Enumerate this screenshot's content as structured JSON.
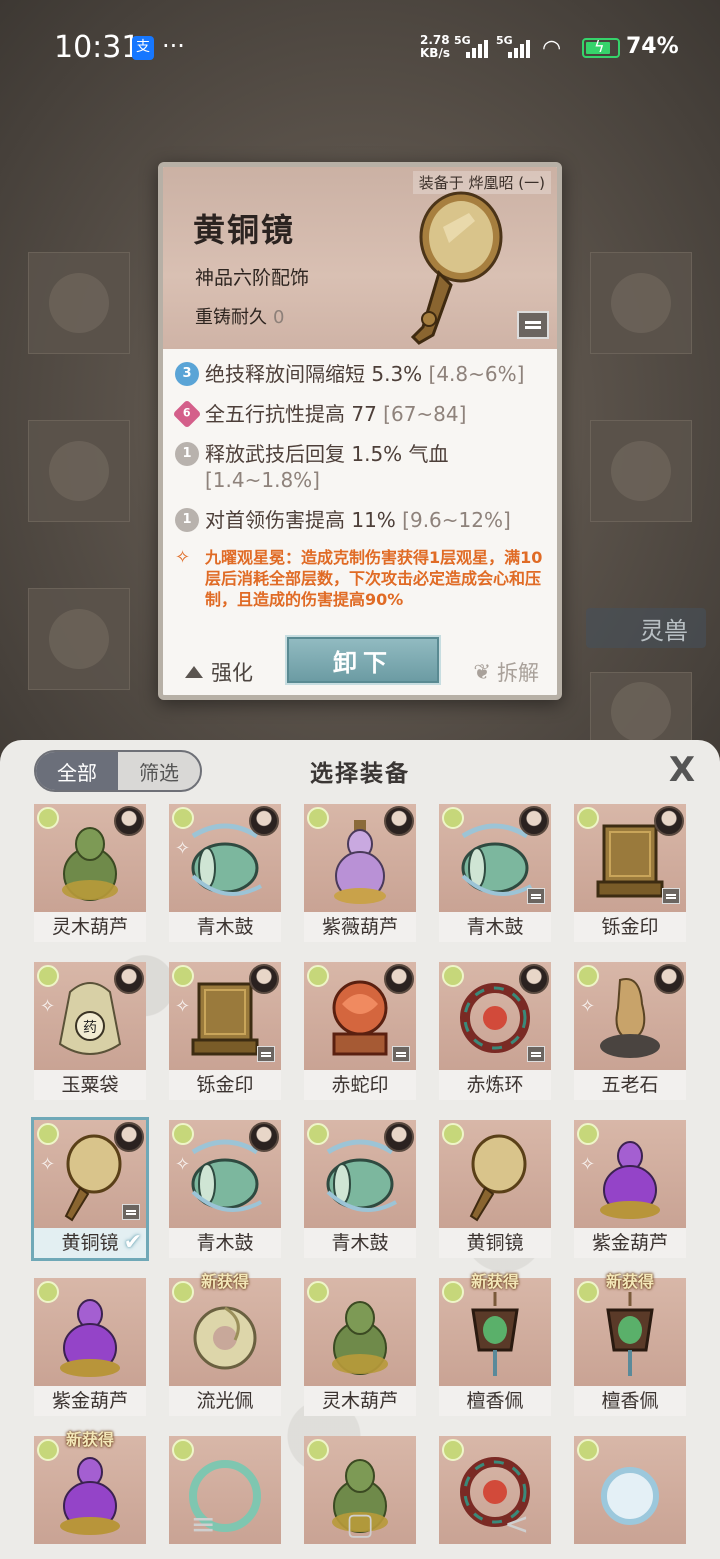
{
  "status": {
    "time": "10:31",
    "alipay": "支",
    "more": "···",
    "net_speed": "2.78",
    "net_unit": "KB/s",
    "sig1": "5G",
    "sig2": "5G",
    "battery": "74%"
  },
  "background": {
    "lingshou": "灵兽"
  },
  "detail": {
    "equipped_by": "装备于 烨凰昭 (一)",
    "name": "黄铜镜",
    "grade": "神品六阶配饰",
    "recast_label": "重铸耐久",
    "recast_value": "0",
    "attrs": [
      {
        "badge": "3",
        "text": "绝技释放间隔缩短 5.3%",
        "range": "[4.8~6%]",
        "color": "#5aa4d6"
      },
      {
        "badge": "6",
        "text": "全五行抗性提高 77",
        "range": "[67~84]",
        "color": "#d45f8a"
      },
      {
        "badge": "1",
        "text": "释放武技后回复 1.5% 气血",
        "range": "[1.4~1.8%]",
        "color": "#b8b2ad"
      },
      {
        "badge": "1",
        "text": "对首领伤害提高 11%",
        "range": "[9.6~12%]",
        "color": "#b8b2ad"
      }
    ],
    "special": "九曜观星冕：造成克制伤害获得1层观星，满10层后消耗全部层数，下次攻击必定造成会心和压制，且造成的伤害提高90%",
    "enhance": "强化",
    "unequip": "卸下",
    "dismantle": "拆解"
  },
  "panel": {
    "tab_all": "全部",
    "tab_filter": "筛选",
    "title": "选择装备",
    "close": "X",
    "new_badge": "新获得",
    "items": [
      {
        "name": "灵木葫芦",
        "art": "gourd-green",
        "avatar": true,
        "rank": false,
        "lock": false,
        "new": false
      },
      {
        "name": "青木鼓",
        "art": "drum",
        "avatar": true,
        "rank": true,
        "lock": false,
        "new": false
      },
      {
        "name": "紫薇葫芦",
        "art": "gourd-purple",
        "avatar": true,
        "rank": false,
        "lock": false,
        "new": false
      },
      {
        "name": "青木鼓",
        "art": "drum",
        "avatar": true,
        "rank": false,
        "lock": true,
        "new": false
      },
      {
        "name": "铄金印",
        "art": "seal",
        "avatar": true,
        "rank": false,
        "lock": true,
        "new": false
      },
      {
        "name": "玉粟袋",
        "art": "bag",
        "avatar": true,
        "rank": true,
        "lock": false,
        "new": false
      },
      {
        "name": "铄金印",
        "art": "seal",
        "avatar": true,
        "rank": true,
        "lock": true,
        "new": false
      },
      {
        "name": "赤蛇印",
        "art": "snake",
        "avatar": true,
        "rank": false,
        "lock": true,
        "new": false
      },
      {
        "name": "赤炼环",
        "art": "ring-red",
        "avatar": true,
        "rank": false,
        "lock": true,
        "new": false
      },
      {
        "name": "五老石",
        "art": "stone",
        "avatar": true,
        "rank": true,
        "lock": false,
        "new": false
      },
      {
        "name": "黄铜镜",
        "art": "mirror",
        "avatar": true,
        "rank": true,
        "lock": true,
        "new": false,
        "selected": true
      },
      {
        "name": "青木鼓",
        "art": "drum",
        "avatar": true,
        "rank": true,
        "lock": false,
        "new": false
      },
      {
        "name": "青木鼓",
        "art": "drum",
        "avatar": true,
        "rank": false,
        "lock": false,
        "new": false
      },
      {
        "name": "黄铜镜",
        "art": "mirror",
        "avatar": false,
        "rank": false,
        "lock": false,
        "new": false
      },
      {
        "name": "紫金葫芦",
        "art": "gourd-purple2",
        "avatar": false,
        "rank": true,
        "lock": false,
        "new": false
      },
      {
        "name": "紫金葫芦",
        "art": "gourd-purple2",
        "avatar": false,
        "rank": false,
        "lock": false,
        "new": false
      },
      {
        "name": "流光佩",
        "art": "pendant-jade",
        "avatar": false,
        "rank": false,
        "lock": false,
        "new": true
      },
      {
        "name": "灵木葫芦",
        "art": "gourd-green",
        "avatar": false,
        "rank": false,
        "lock": false,
        "new": false
      },
      {
        "name": "檀香佩",
        "art": "pendant-green",
        "avatar": false,
        "rank": false,
        "lock": false,
        "new": true
      },
      {
        "name": "檀香佩",
        "art": "pendant-green",
        "avatar": false,
        "rank": false,
        "lock": false,
        "new": true
      },
      {
        "name": "",
        "art": "gourd-purple2",
        "avatar": false,
        "rank": false,
        "lock": false,
        "new": true
      },
      {
        "name": "",
        "art": "ring-jade",
        "avatar": false,
        "rank": false,
        "lock": false,
        "new": false
      },
      {
        "name": "",
        "art": "gourd-green",
        "avatar": false,
        "rank": false,
        "lock": false,
        "new": false
      },
      {
        "name": "",
        "art": "ring-red",
        "avatar": false,
        "rank": false,
        "lock": false,
        "new": false
      },
      {
        "name": "",
        "art": "ring-blue",
        "avatar": false,
        "rank": false,
        "lock": false,
        "new": false
      }
    ]
  },
  "nav": {
    "menu": "≡",
    "home": "▢",
    "back": "<"
  }
}
